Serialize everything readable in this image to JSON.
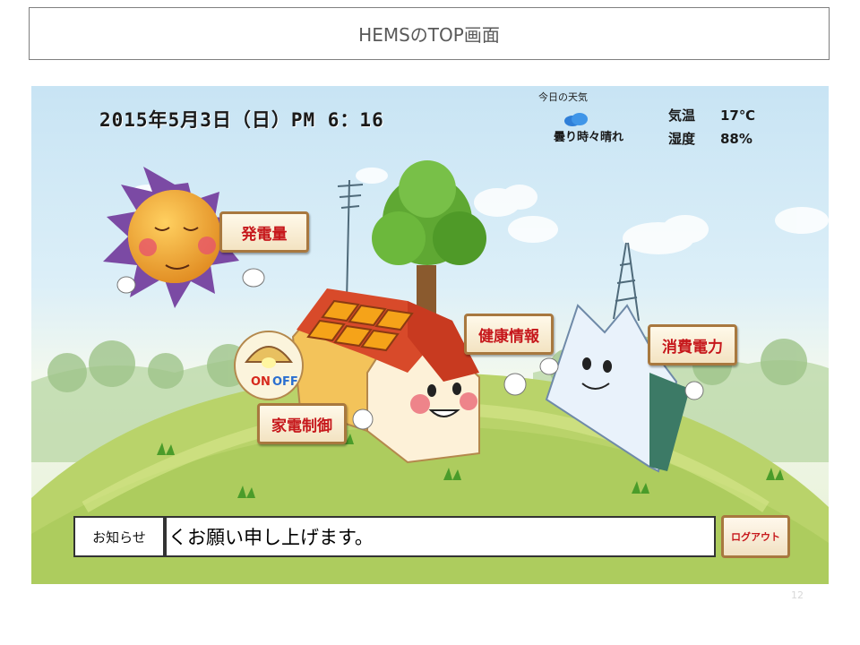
{
  "slide": {
    "title": "HEMSのTOP画面",
    "page_number": "12"
  },
  "screen": {
    "datetime": "2015年5月3日（日）PM 6：16",
    "weather": {
      "title": "今日の天気",
      "icon": "cloud-icon",
      "condition": "曇り時々晴れ",
      "temp_label": "気温",
      "temp_value": "17℃",
      "humidity_label": "湿度",
      "humidity_value": "88%"
    },
    "buttons": {
      "generation": "発電量",
      "health": "健康情報",
      "consumption": "消費電力",
      "appliance": "家電制御"
    },
    "lamp": {
      "on": "ON",
      "off": "OFF"
    },
    "notice": {
      "label": "お知らせ",
      "text": "くお願い申し上げます。"
    },
    "logout": "ログアウト"
  },
  "colors": {
    "sign_text": "#c6171b",
    "sign_border": "#a8783f",
    "hill": "#b9d36a",
    "sun": "#f0a030"
  }
}
